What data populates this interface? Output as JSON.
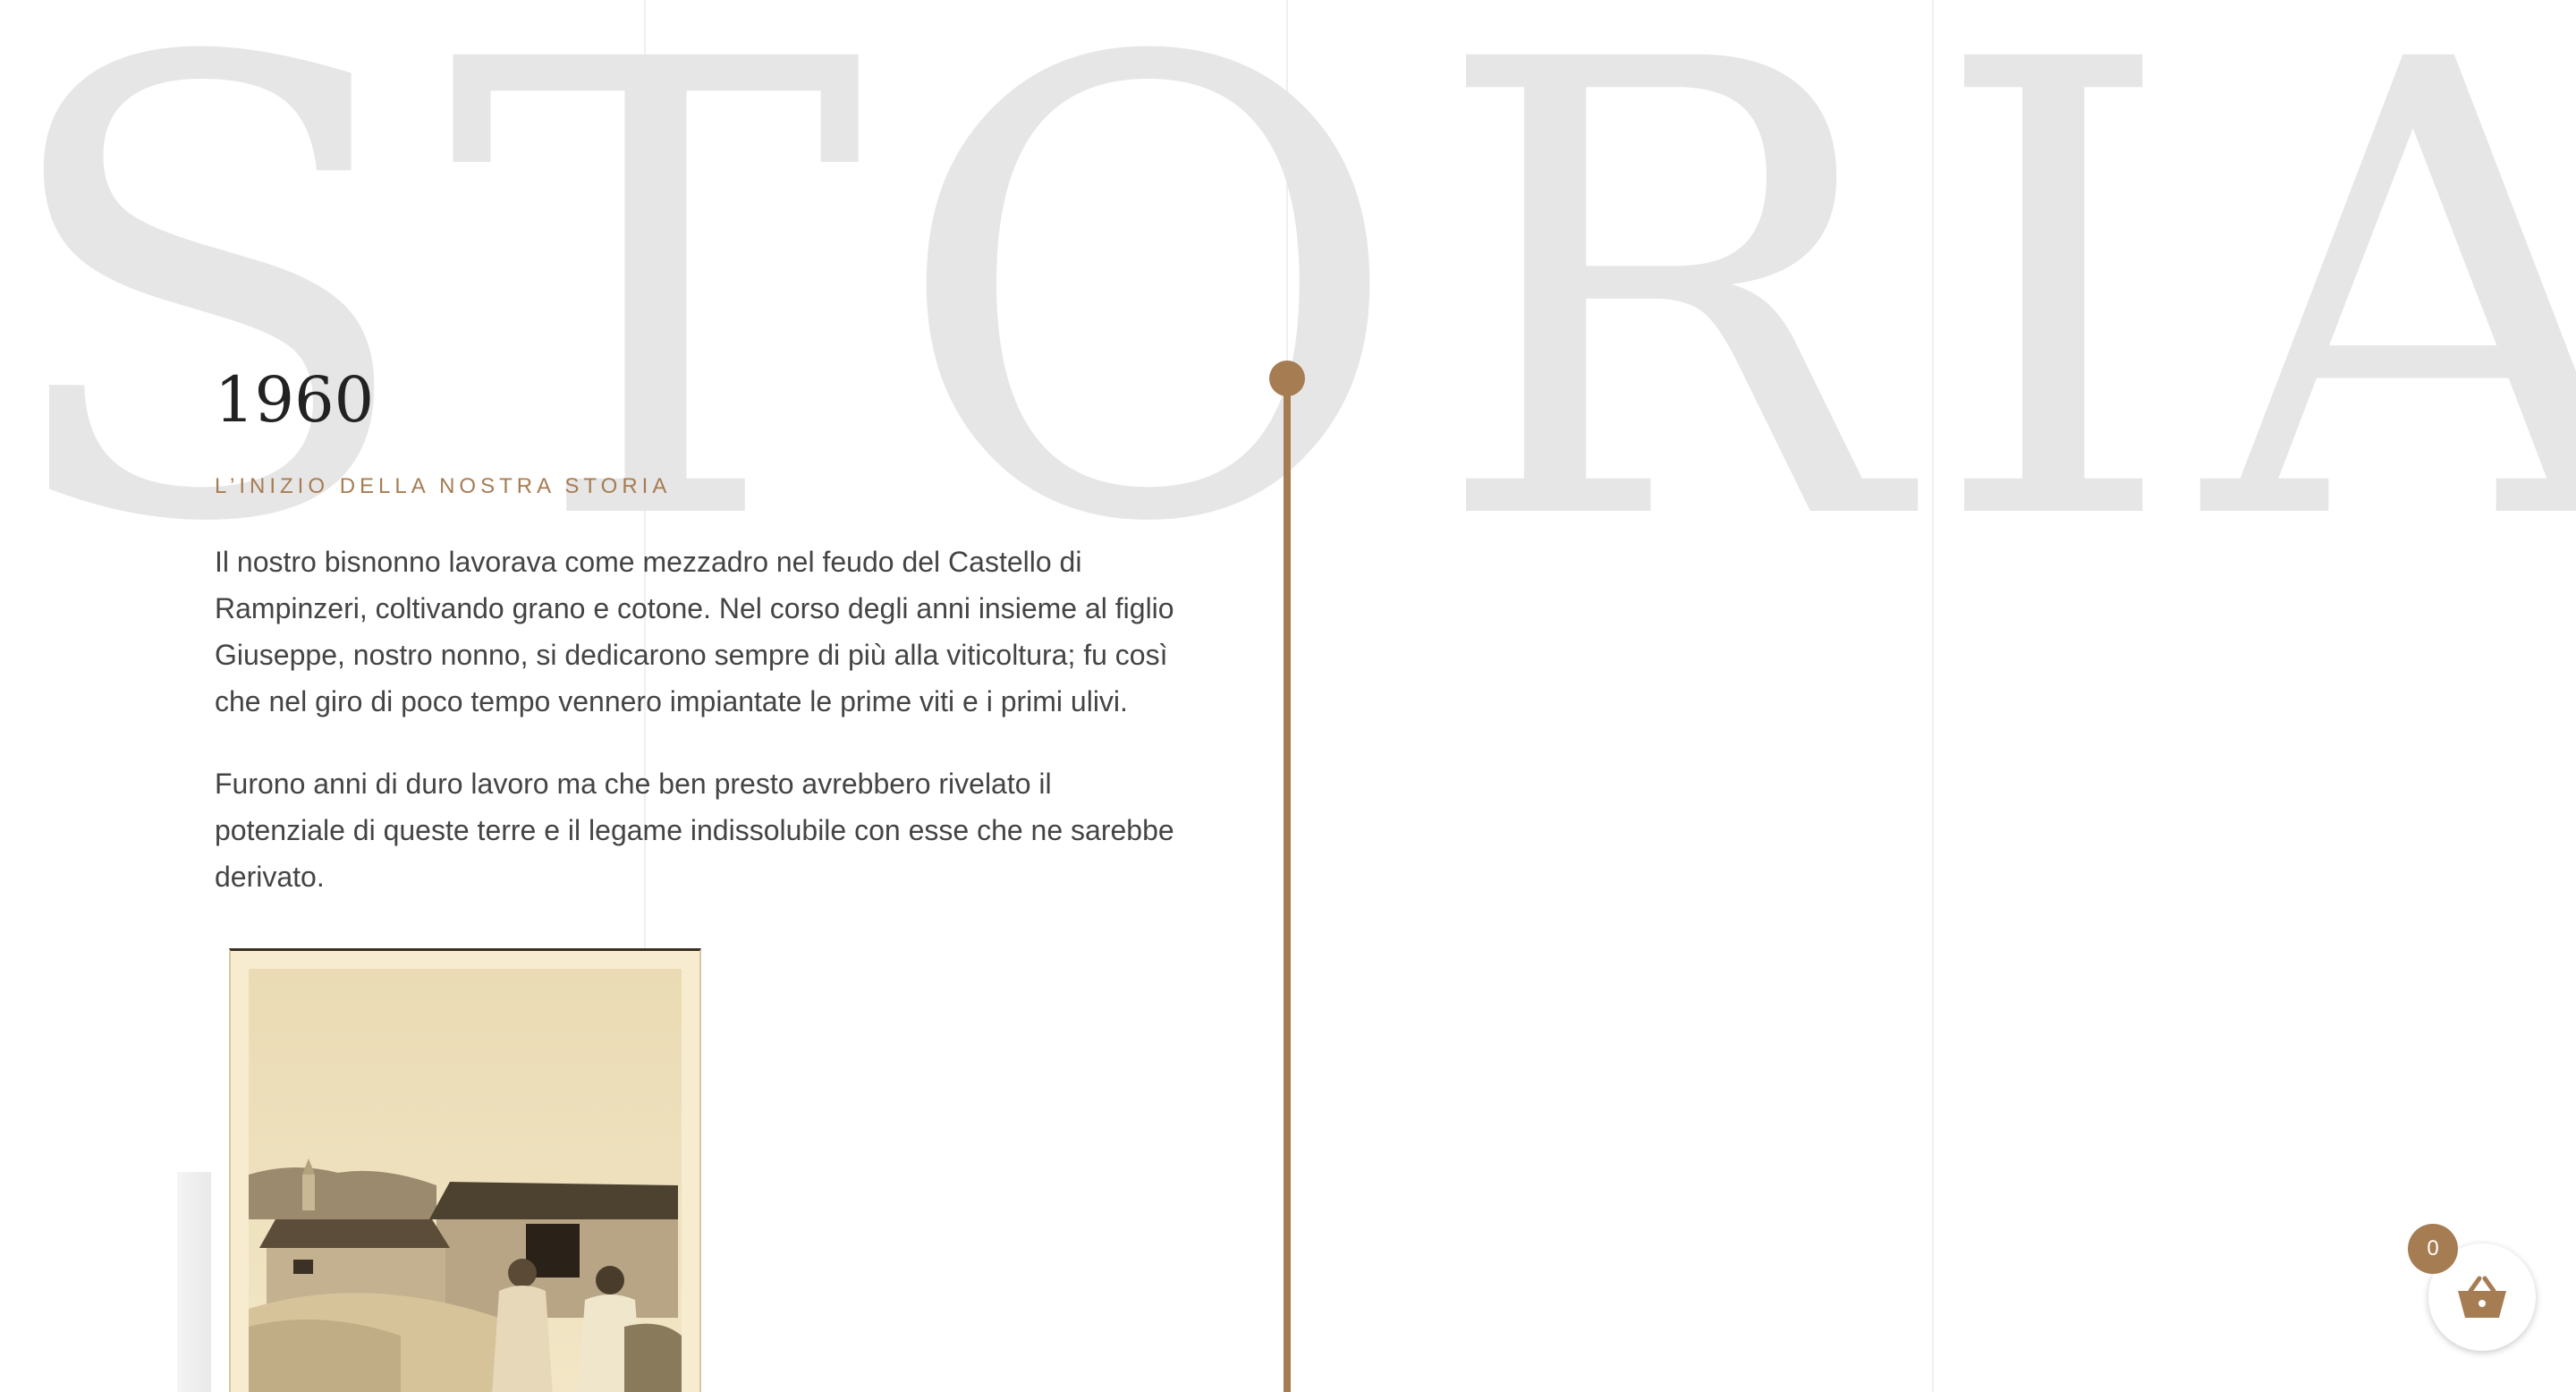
{
  "background_word": "STORIA",
  "timeline": {
    "year": "1960",
    "subtitle": "L’INIZIO DELLA NOSTRA STORIA",
    "paragraphs": [
      "Il nostro bisnonno lavorava come mezzadro nel feudo del Castello di Rampinzeri, coltivando grano e cotone. Nel corso degli anni insieme al figlio Giuseppe, nostro nonno, si dedicarono sempre di più alla viticoltura; fu così che nel giro di poco tempo vennero impiantate le prime viti e i primi ulivi.",
      "Furono anni di duro lavoro ma che ben presto avrebbero rivelato il potenziale di queste terre e il legame indissolubile con esse che ne sarebbe derivato."
    ],
    "accent_color": "#a67c52"
  },
  "cart": {
    "count": "0",
    "icon": "basket-icon"
  }
}
